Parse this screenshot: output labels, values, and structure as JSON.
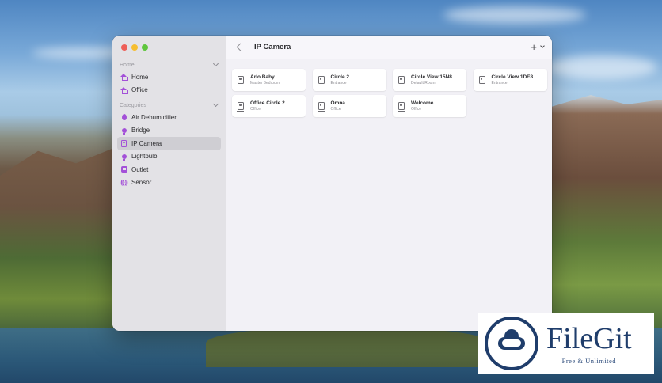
{
  "window": {
    "sidebar": {
      "sections": [
        {
          "title": "Home",
          "items": [
            {
              "label": "Home",
              "icon": "house-icon"
            },
            {
              "label": "Office",
              "icon": "house-icon"
            }
          ]
        },
        {
          "title": "Categories",
          "items": [
            {
              "label": "Air Dehumidifier",
              "icon": "drop-icon"
            },
            {
              "label": "Bridge",
              "icon": "bridge-icon"
            },
            {
              "label": "IP Camera",
              "icon": "camera-icon",
              "selected": true
            },
            {
              "label": "Lightbulb",
              "icon": "lightbulb-icon"
            },
            {
              "label": "Outlet",
              "icon": "outlet-icon"
            },
            {
              "label": "Sensor",
              "icon": "sensor-icon"
            }
          ]
        }
      ]
    },
    "toolbar": {
      "title": "IP Camera",
      "add_label": "+"
    },
    "accessories": [
      {
        "name": "Arlo Baby",
        "room": "Master Bedroom"
      },
      {
        "name": "Circle 2",
        "room": "Entrance"
      },
      {
        "name": "Circle View 15N8",
        "room": "Default Room"
      },
      {
        "name": "Circle View 1DE8",
        "room": "Entrance"
      },
      {
        "name": "Office Circle 2",
        "room": "Office"
      },
      {
        "name": "Omna",
        "room": "Office"
      },
      {
        "name": "Welcome",
        "room": "Office"
      }
    ],
    "accent_color": "#a350d8"
  },
  "watermark": {
    "name": "FileGit",
    "tagline": "Free & Unlimited"
  }
}
